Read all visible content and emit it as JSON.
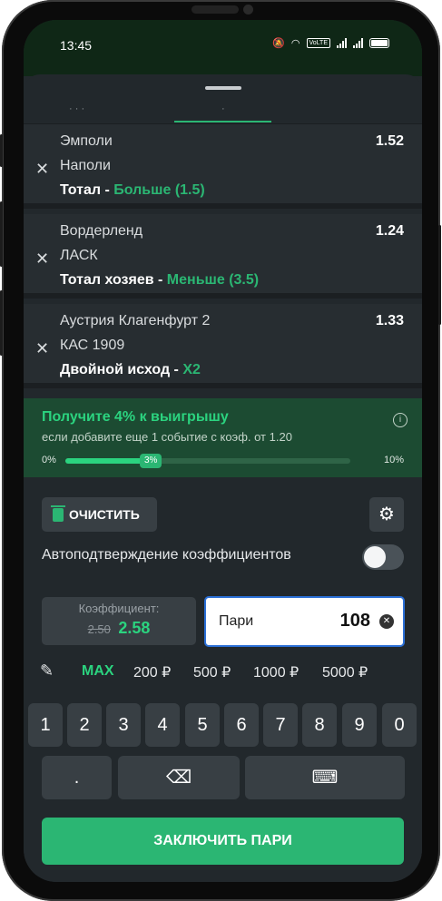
{
  "status_bar": {
    "time": "13:45",
    "volte": "VoLTE"
  },
  "tabs": {
    "left_ghost": "· · ·",
    "right_ghost": "·"
  },
  "bets": [
    {
      "team_home": "Эмполи",
      "team_away": "Наполи",
      "odds": "1.52",
      "market": "Тотал",
      "separator": " - ",
      "pick": "Больше (1.5)"
    },
    {
      "team_home": "Вордерленд",
      "team_away": "ЛАСК",
      "odds": "1.24",
      "market": "Тотал хозяев",
      "separator": " - ",
      "pick": "Меньше (3.5)"
    },
    {
      "team_home": "Аустрия Клагенфурт 2",
      "team_away": "КАС 1909",
      "odds": "1.33",
      "market": "Двойной исход",
      "separator": " - ",
      "pick": "Х2"
    }
  ],
  "remove_glyph": "✕",
  "promo": {
    "title": "Получите 4% к выигрышу",
    "subtitle": "если добавите еще 1 событие с коэф. от 1.20",
    "info_glyph": "i",
    "min_label": "0%",
    "max_label": "10%",
    "progress_label": "3%",
    "progress_fraction": 0.3
  },
  "actions": {
    "clear_label": "ОЧИСТИТЬ",
    "gear_glyph": "⚙"
  },
  "auto_confirm": {
    "label": "Автоподтверждение коэффициентов",
    "enabled": false
  },
  "coefficient": {
    "label": "Коэффициент:",
    "old_value": "2.50",
    "new_value": "2.58"
  },
  "stake": {
    "label": "Пари",
    "value": "108",
    "clear_glyph": "✕"
  },
  "quick_amounts": {
    "pencil_glyph": "✎",
    "max": "MAX",
    "amounts": [
      "200 ₽",
      "500 ₽",
      "1000 ₽",
      "5000 ₽"
    ]
  },
  "keypad": {
    "digits": [
      "1",
      "2",
      "3",
      "4",
      "5",
      "6",
      "7",
      "8",
      "9",
      "0"
    ],
    "dot": ".",
    "backspace_glyph": "⌫",
    "keyboard_glyph": "⌨"
  },
  "submit_label": "ЗАКЛЮЧИТЬ ПАРИ",
  "colors": {
    "accent_green": "#2bb673",
    "bright_green": "#2bd37f",
    "sheet_bg": "#22282c",
    "stake_border": "#2b6fd6"
  }
}
